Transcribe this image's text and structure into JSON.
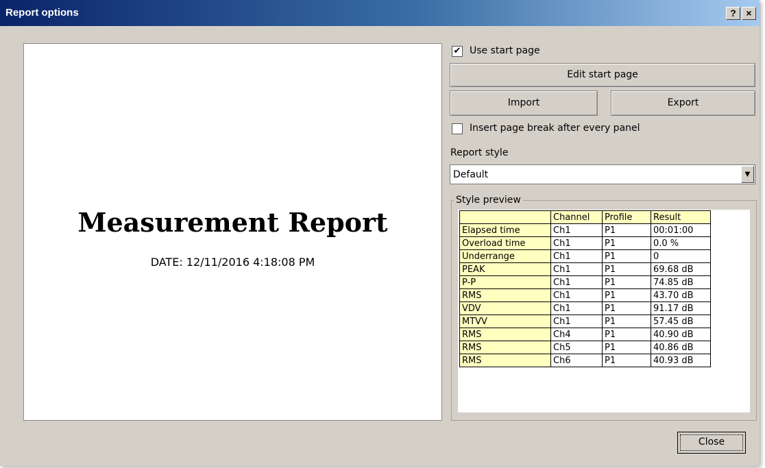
{
  "window": {
    "title": "Report options",
    "help_label": "?",
    "close_label": "×"
  },
  "preview": {
    "title": "Measurement Report",
    "date": "DATE: 12/11/2016 4:18:08 PM"
  },
  "options": {
    "use_start_page": {
      "label": "Use start page",
      "checked": true,
      "mark": "✔"
    },
    "edit_start_page": "Edit start page",
    "import": "Import",
    "export": "Export",
    "page_break": {
      "label": "Insert page break after every panel",
      "checked": false,
      "mark": ""
    },
    "report_style_label": "Report style",
    "report_style_value": "Default",
    "style_preview_label": "Style preview"
  },
  "table": {
    "headers": [
      "",
      "Channel",
      "Profile",
      "Result"
    ],
    "rows": [
      [
        "Elapsed time",
        "Ch1",
        "P1",
        "00:01:00"
      ],
      [
        "Overload time",
        "Ch1",
        "P1",
        "0.0 %"
      ],
      [
        "Underrange",
        "Ch1",
        "P1",
        "0"
      ],
      [
        "PEAK",
        "Ch1",
        "P1",
        "69.68 dB"
      ],
      [
        "P-P",
        "Ch1",
        "P1",
        "74.85 dB"
      ],
      [
        "RMS",
        "Ch1",
        "P1",
        "43.70 dB"
      ],
      [
        "VDV",
        "Ch1",
        "P1",
        "91.17 dB"
      ],
      [
        "MTVV",
        "Ch1",
        "P1",
        "57.45 dB"
      ],
      [
        "RMS",
        "Ch4",
        "P1",
        "40.90 dB"
      ],
      [
        "RMS",
        "Ch5",
        "P1",
        "40.86 dB"
      ],
      [
        "RMS",
        "Ch6",
        "P1",
        "40.93 dB"
      ]
    ]
  },
  "footer": {
    "close": "Close"
  },
  "colors": {
    "title_start": "#0a246a",
    "title_end": "#a6caf0",
    "cell_highlight": "#ffffc0",
    "dialog_bg": "#d4d0c8"
  }
}
